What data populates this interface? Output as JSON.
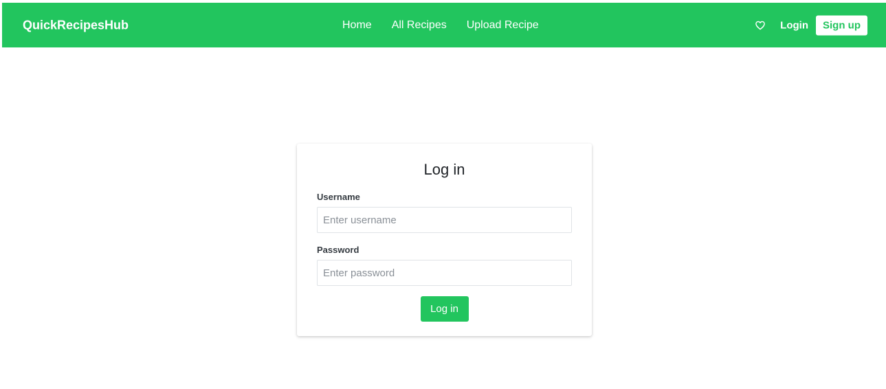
{
  "navbar": {
    "brand": "QuickRecipesHub",
    "links": [
      {
        "label": "Home"
      },
      {
        "label": "All Recipes"
      },
      {
        "label": "Upload Recipe"
      }
    ],
    "favorites_icon": "heart-outline-icon",
    "login_label": "Login",
    "signup_label": "Sign up"
  },
  "login_form": {
    "title": "Log in",
    "username": {
      "label": "Username",
      "placeholder": "Enter username",
      "value": ""
    },
    "password": {
      "label": "Password",
      "placeholder": "Enter password",
      "value": ""
    },
    "submit_label": "Log in"
  },
  "colors": {
    "brand_green": "#22c55e",
    "white": "#ffffff",
    "input_border": "#dfe3e6"
  }
}
